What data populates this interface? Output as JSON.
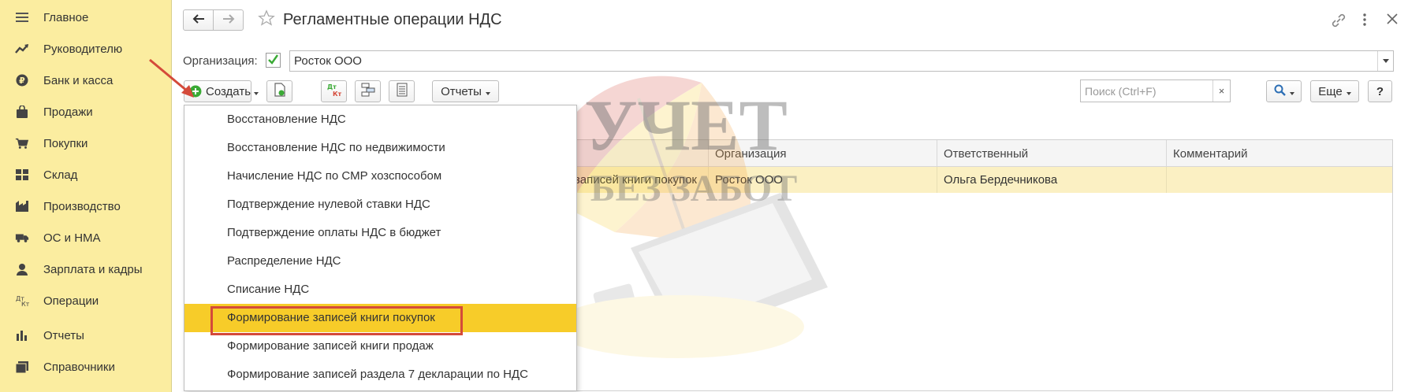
{
  "sidebar": {
    "items": [
      {
        "label": "Главное",
        "icon": "menu-icon"
      },
      {
        "label": "Руководителю",
        "icon": "trend-icon"
      },
      {
        "label": "Банк и касса",
        "icon": "ruble-icon"
      },
      {
        "label": "Продажи",
        "icon": "bag-icon"
      },
      {
        "label": "Покупки",
        "icon": "cart-icon"
      },
      {
        "label": "Склад",
        "icon": "warehouse-icon"
      },
      {
        "label": "Производство",
        "icon": "factory-icon"
      },
      {
        "label": "ОС и НМА",
        "icon": "truck-icon"
      },
      {
        "label": "Зарплата и кадры",
        "icon": "person-icon"
      },
      {
        "label": "Операции",
        "icon": "dt-kt-icon"
      },
      {
        "label": "Отчеты",
        "icon": "bar-chart-icon"
      },
      {
        "label": "Справочники",
        "icon": "books-icon"
      }
    ]
  },
  "header": {
    "title": "Регламентные операции НДС"
  },
  "org": {
    "label": "Организация:",
    "value": "Росток ООО",
    "checked": true
  },
  "toolbar": {
    "create_label": "Создать",
    "reports_label": "Отчеты",
    "search_placeholder": "Поиск (Ctrl+F)",
    "search_clear": "×",
    "more_label": "Еще",
    "help_label": "?",
    "dt_kt_icon_text": "Дт Кт"
  },
  "table": {
    "columns": [
      "Организация",
      "Ответственный",
      "Комментарий"
    ],
    "rows": [
      {
        "type_fragment": "записей книги покупок",
        "org": "Росток ООО",
        "responsible": "Ольга Бердечникова",
        "comment": ""
      }
    ]
  },
  "menu": {
    "items": [
      "Восстановление НДС",
      "Восстановление НДС по недвижимости",
      "Начисление НДС по СМР хозспособом",
      "Подтверждение нулевой ставки НДС",
      "Подтверждение оплаты НДС в бюджет",
      "Распределение НДС",
      "Списание НДС",
      "Формирование записей книги покупок",
      "Формирование записей книги продаж",
      "Формирование записей раздела 7 декларации по НДС"
    ],
    "selected_index": 7
  },
  "watermark": {
    "line1": "УЧЕТ",
    "line2": "БЕЗ ЗАБОТ"
  },
  "colors": {
    "sidebar_bg": "#fbeda0",
    "selected_bg": "#f7cc29",
    "highlight_border": "#d44a3a",
    "row_bg": "#fbf0c3",
    "accent_green": "#3aaa35"
  }
}
